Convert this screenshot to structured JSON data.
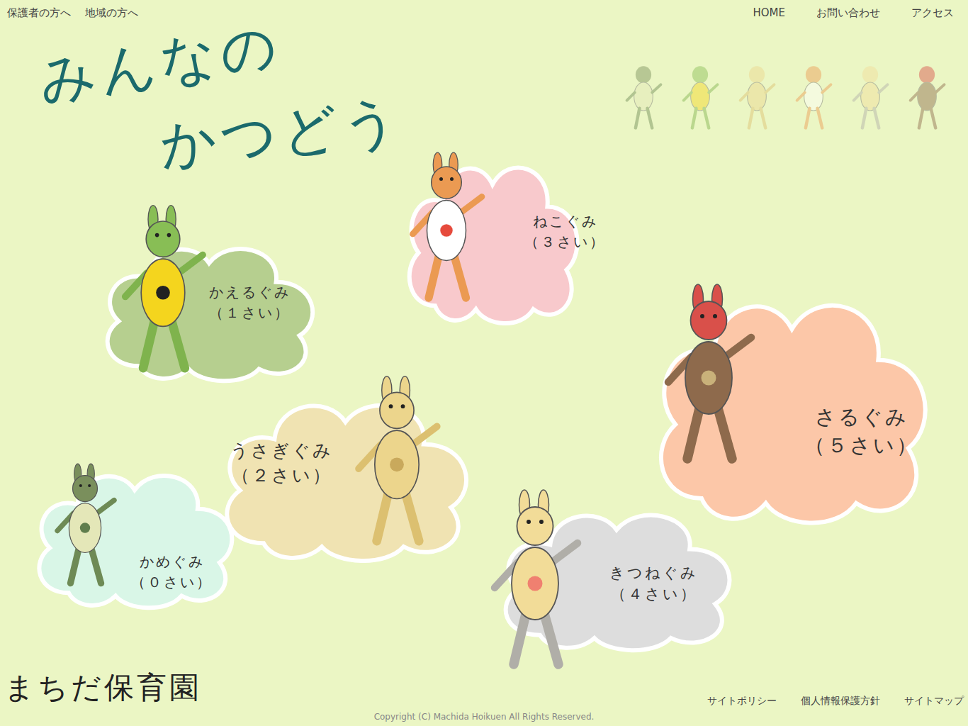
{
  "nav": {
    "left": [
      "保護者の方へ",
      "地域の方へ"
    ],
    "right": [
      "HOME",
      "お問い合わせ",
      "アクセス"
    ]
  },
  "title": [
    "みんなの",
    "かつどう"
  ],
  "groups": [
    {
      "name": "かめぐみ",
      "age": "（０さい）",
      "color": "#d9f6e7"
    },
    {
      "name": "かえるぐみ",
      "age": "（１さい）",
      "color": "#b6cf8f"
    },
    {
      "name": "うさぎぐみ",
      "age": "（２さい）",
      "color": "#f0e3b2"
    },
    {
      "name": "ねこぐみ",
      "age": "（３さい）",
      "color": "#f8c9cc"
    },
    {
      "name": "きつねぐみ",
      "age": "（４さい）",
      "color": "#dddddd"
    },
    {
      "name": "さるぐみ",
      "age": "（５さい）",
      "color": "#fcc7a8"
    }
  ],
  "footer": {
    "logo": "まちだ保育園",
    "copyright": "Copyright (C) Machida Hoikuen All Rights Reserved.",
    "links": [
      "サイトポリシー",
      "個人情報保護方針",
      "サイトマップ"
    ]
  }
}
